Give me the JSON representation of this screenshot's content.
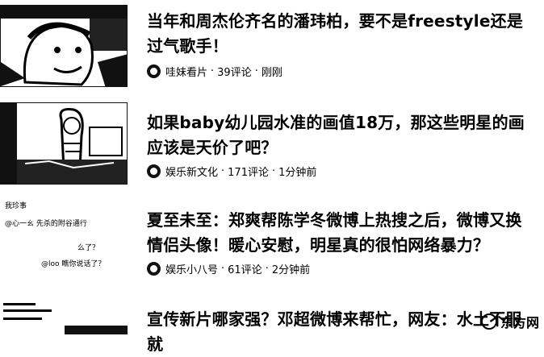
{
  "articles": [
    {
      "title": "当年和周杰伦齐名的潘玮柏，要不是freestyle还是过气歌手！",
      "source": "哇妹看片",
      "comments": "39评论",
      "time": "刚刚"
    },
    {
      "title": "如果baby幼儿园水准的画值18万，那这些明星的画应该是天价了吧？",
      "source": "娱乐新文化",
      "comments": "171评论",
      "time": "1分钟前"
    },
    {
      "title": "夏至未至：郑爽帮陈学冬微博上热搜之后，微博又换情侣头像！暖心安慰，明星真的很怕网络暴力？",
      "source": "娱乐小八号",
      "comments": "61评论",
      "time": "2分钟前",
      "thumb_text": [
        "我珍事",
        "@心一ㄠ 先杀的附谷通行",
        "么了？",
        "@loo 瞧你说话了？"
      ]
    },
    {
      "title": "宣传新片哪家强？邓超微博来帮忙，网友：水土不服就",
      "source": "",
      "comments": "",
      "time": ""
    }
  ],
  "separator": "·",
  "watermark": "东方网"
}
